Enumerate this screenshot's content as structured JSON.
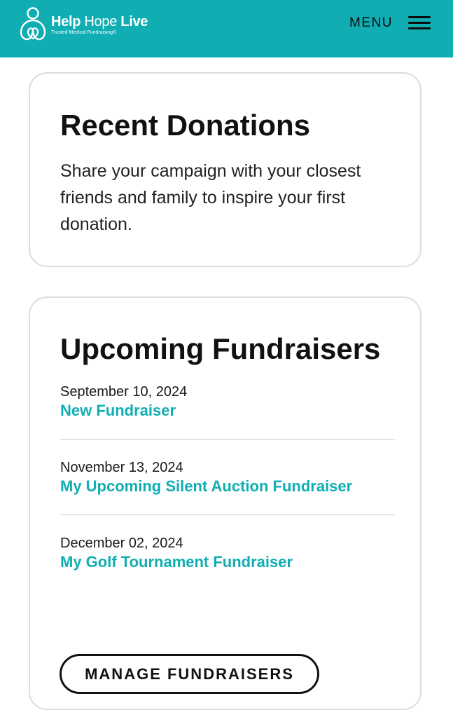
{
  "header": {
    "brand": {
      "word1": "Help",
      "word2": "Hope",
      "word3": "Live",
      "tagline": "Trusted Medical Fundraising®"
    },
    "menu_label": "MENU"
  },
  "recent_donations": {
    "title": "Recent Donations",
    "body": "Share your campaign with your closest friends and family to inspire your first donation."
  },
  "upcoming_fundraisers": {
    "title": "Upcoming Fundraisers",
    "items": [
      {
        "date": "September 10, 2024",
        "name": "New Fundraiser"
      },
      {
        "date": "November 13, 2024",
        "name": "My Upcoming Silent Auction Fundraiser"
      },
      {
        "date": "December 02, 2024",
        "name": "My Golf Tournament Fundraiser"
      }
    ],
    "button_label": "MANAGE FUNDRAISERS"
  },
  "colors": {
    "brand": "#10aeb3",
    "text": "#111111",
    "border": "#dcdcdc"
  },
  "icons": {
    "logo": "people-heart-logo-icon",
    "menu": "hamburger-menu-icon"
  }
}
